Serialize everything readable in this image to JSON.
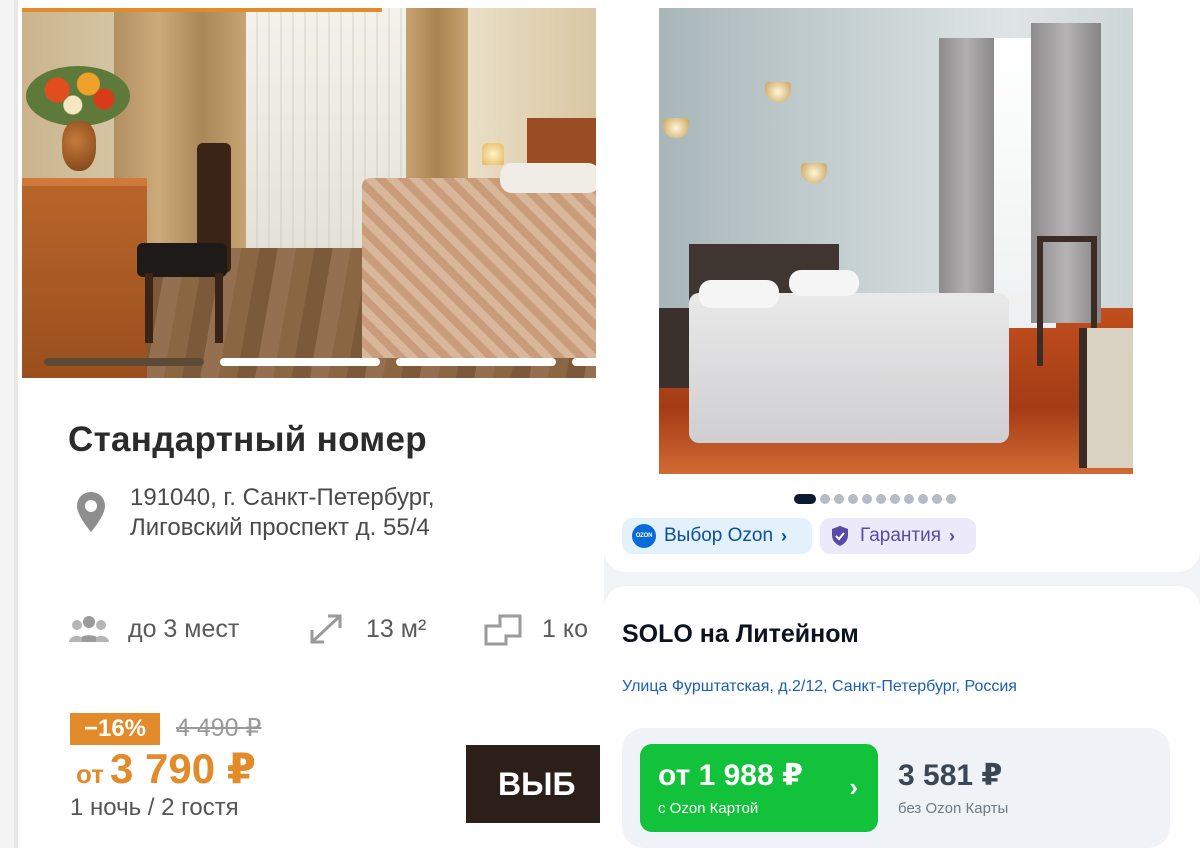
{
  "left_card": {
    "title": "Стандартный номер",
    "address_line1": "191040, г. Санкт-Петербург,",
    "address_line2": "Лиговский проспект д. 55/4",
    "features": {
      "guests": "до 3 мест",
      "area": "13 м²",
      "rooms": "1 ко"
    },
    "discount": "−16%",
    "old_price": "4 490 ₽",
    "price_prefix": "от",
    "price": "3 790 ₽",
    "nights_guests": "1 ночь / 2 гостя",
    "select_label": "ВЫБ",
    "accent_color": "#e38a2a"
  },
  "right_card": {
    "chips": {
      "ozon_choice": "Выбор Ozon",
      "guarantee": "Гарантия"
    },
    "ozon_logo_text": "OZON",
    "hotel_name": "SOLO на Литейном",
    "hotel_address": "Улица Фурштатская, д.2/12, Санкт-Петербург, Россия",
    "price_with_card": "от 1 988 ₽",
    "price_with_card_sub": "с Ozon Картой",
    "price_without_card": "3 581 ₽",
    "price_without_card_sub": "без Ozon Карты",
    "accent_green": "#12c23a",
    "photo_dot_count": 11
  }
}
